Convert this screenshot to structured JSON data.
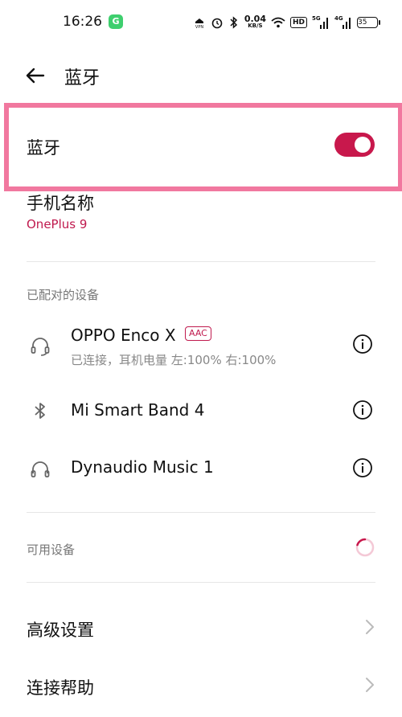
{
  "status_bar": {
    "time": "16:26",
    "app_badge": "G",
    "speed_value": "0.04",
    "speed_unit": "KB/S",
    "hd_label": "HD",
    "net1": "5G",
    "net2": "4G",
    "battery": "35"
  },
  "header": {
    "title": "蓝牙"
  },
  "bluetooth": {
    "label": "蓝牙",
    "enabled": true,
    "accent_color": "#c8184c"
  },
  "phone_name": {
    "label": "手机名称",
    "value": "OnePlus 9"
  },
  "paired_section": {
    "header": "已配对的设备",
    "devices": [
      {
        "name": "OPPO Enco X",
        "badge": "AAC",
        "status": "已连接，耳机电量 左:100% 右:100%",
        "icon": "headset-icon"
      },
      {
        "name": "Mi Smart Band 4",
        "icon": "bluetooth-icon"
      },
      {
        "name": "Dynaudio Music 1",
        "icon": "headphones-icon"
      }
    ]
  },
  "available_section": {
    "header": "可用设备"
  },
  "menu": [
    {
      "label": "高级设置"
    },
    {
      "label": "连接帮助"
    }
  ]
}
